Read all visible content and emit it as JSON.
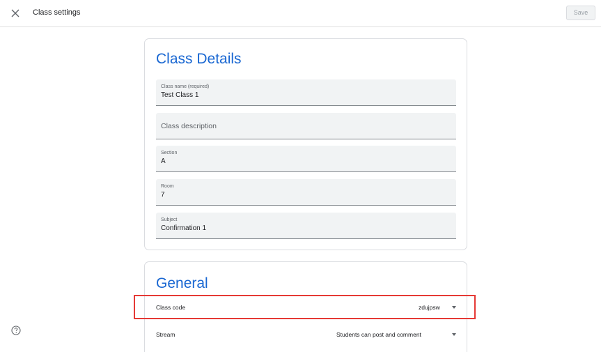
{
  "header": {
    "title": "Class settings",
    "close_icon": "close-icon",
    "save_label": "Save"
  },
  "details": {
    "title": "Class Details",
    "fields": [
      {
        "label": "Class name (required)",
        "value": "Test Class 1",
        "placeholder": ""
      },
      {
        "label": "",
        "value": "",
        "placeholder": "Class description"
      },
      {
        "label": "Section",
        "value": "A",
        "placeholder": ""
      },
      {
        "label": "Room",
        "value": "7",
        "placeholder": ""
      },
      {
        "label": "Subject",
        "value": "Confirmation 1",
        "placeholder": ""
      }
    ]
  },
  "general": {
    "title": "General",
    "class_code_label": "Class code",
    "class_code_value": "zdujpsw",
    "stream_label": "Stream",
    "stream_value": "Students can post and comment"
  },
  "footer": {
    "help_icon": "help-icon"
  },
  "colors": {
    "accent": "#1967d2",
    "highlight": "#e53935"
  }
}
